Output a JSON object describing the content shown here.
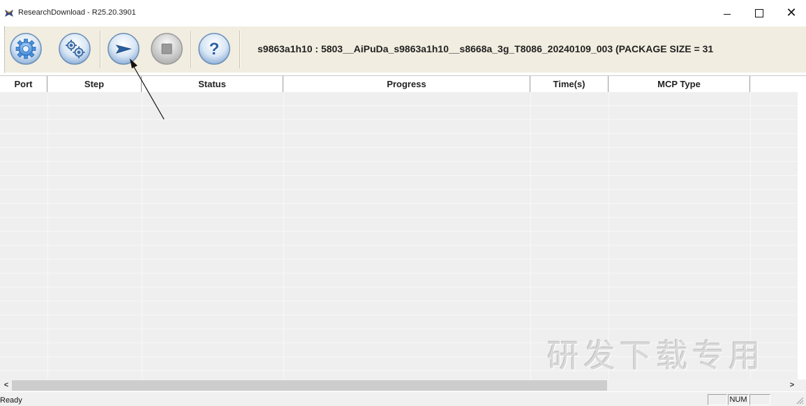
{
  "window": {
    "title": "ResearchDownload - R25.20.3901",
    "controls": {
      "minimize_icon": "minimize-icon",
      "maximize_icon": "maximize-icon",
      "close_label": "✕"
    }
  },
  "toolbar": {
    "buttons": [
      {
        "name": "settings-gear-button",
        "icon": "gear-icon"
      },
      {
        "name": "load-packet-button",
        "icon": "double-gear-icon"
      },
      {
        "name": "start-download-button",
        "icon": "play-arrow-icon"
      },
      {
        "name": "stop-download-button",
        "icon": "stop-square-icon"
      },
      {
        "name": "help-button",
        "icon": "question-mark-icon",
        "glyph": "?"
      }
    ],
    "package_info": "s9863a1h10 : 5803__AiPuDa_s9863a1h10__s8668a_3g_T8086_20240109_003 (PACKAGE SIZE = 31"
  },
  "table": {
    "columns": [
      "Port",
      "Step",
      "Status",
      "Progress",
      "Time(s)",
      "MCP Type",
      ""
    ],
    "rows": []
  },
  "watermark": "研发下载专用",
  "scrollbar": {
    "left_arrow": "<",
    "right_arrow": ">"
  },
  "statusbar": {
    "text": "Ready",
    "indicators": [
      "",
      "NUM",
      ""
    ]
  },
  "colors": {
    "toolbar_bg": "#f1ede0",
    "grid_bg": "#efefef",
    "button_blue": "#6aa8e8",
    "button_gray": "#c8c8c8"
  }
}
